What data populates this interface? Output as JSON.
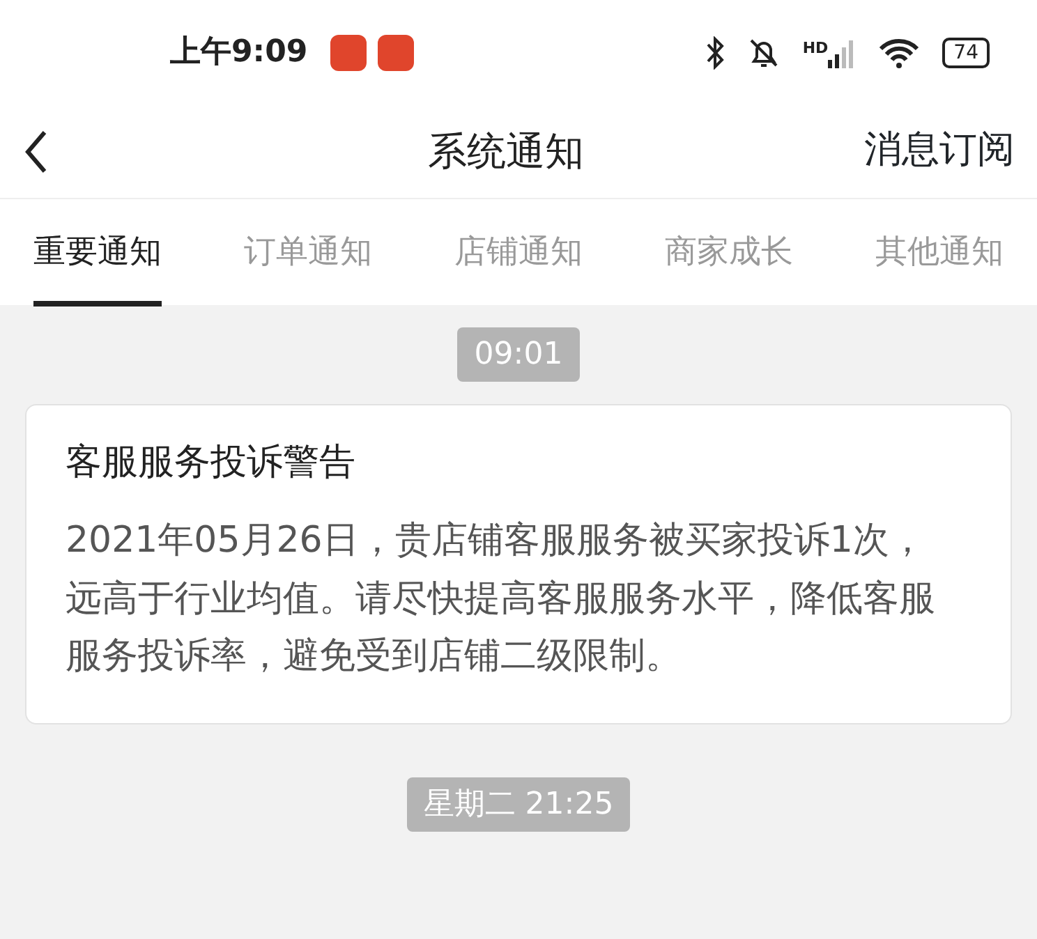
{
  "status_bar": {
    "time": "上午9:09",
    "signal_label": "HD",
    "battery": "74"
  },
  "header": {
    "title": "系统通知",
    "action": "消息订阅"
  },
  "tabs": [
    {
      "label": "重要通知",
      "selected": true
    },
    {
      "label": "订单通知",
      "selected": false
    },
    {
      "label": "店铺通知",
      "selected": false
    },
    {
      "label": "商家成长",
      "selected": false
    },
    {
      "label": "其他通知",
      "selected": false
    }
  ],
  "messages": [
    {
      "time": "09:01",
      "title": "客服服务投诉警告",
      "body": "2021年05月26日，贵店铺客服服务被买家投诉1次，远高于行业均值。请尽快提高客服服务水平，降低客服服务投诉率，避免受到店铺二级限制。"
    },
    {
      "time": "星期二 21:25"
    }
  ]
}
